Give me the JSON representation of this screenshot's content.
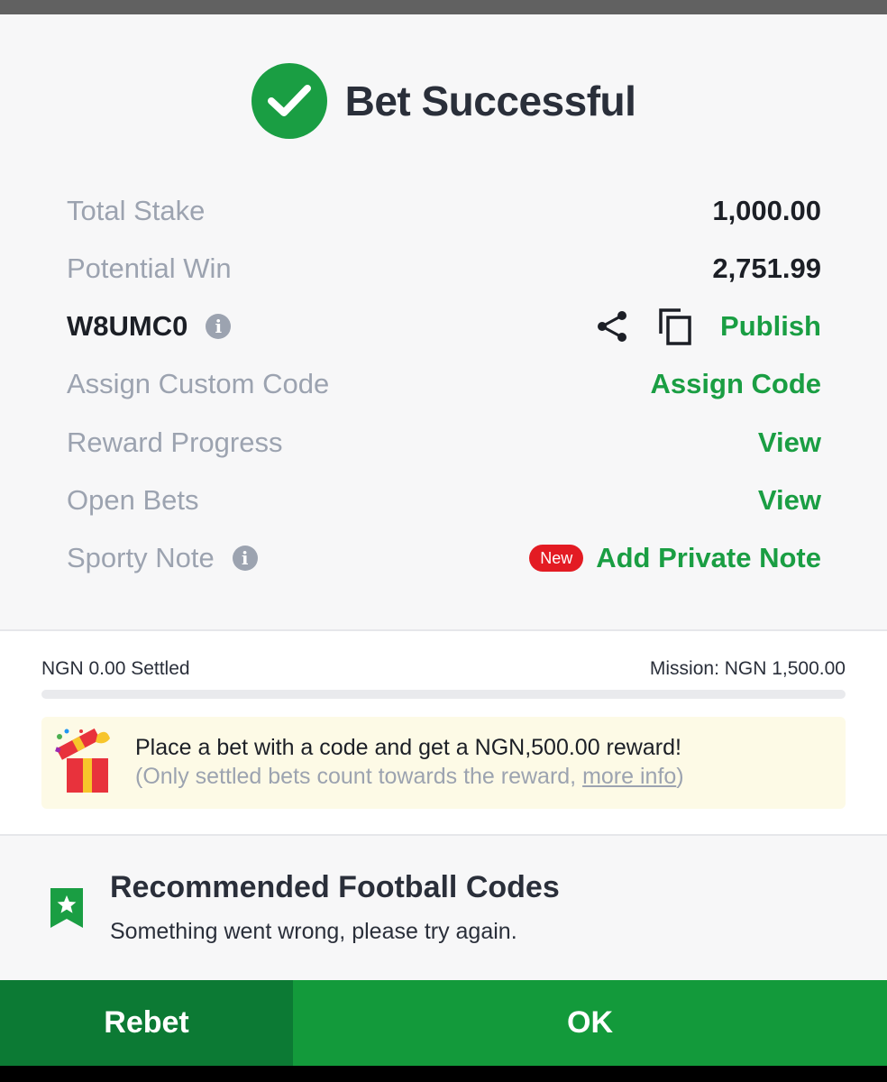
{
  "header": {
    "title": "Bet Successful"
  },
  "summary": {
    "total_stake_label": "Total Stake",
    "total_stake_value": "1,000.00",
    "potential_win_label": "Potential Win",
    "potential_win_value": "2,751.99",
    "booking_code": "W8UMC0",
    "publish_label": "Publish",
    "assign_custom_code_label": "Assign Custom Code",
    "assign_code_link": "Assign Code",
    "reward_progress_label": "Reward Progress",
    "reward_progress_link": "View",
    "open_bets_label": "Open Bets",
    "open_bets_link": "View",
    "sporty_note_label": "Sporty Note",
    "new_badge": "New",
    "add_private_note_link": "Add Private Note"
  },
  "mission": {
    "settled": "NGN 0.00 Settled",
    "target": "Mission: NGN 1,500.00",
    "progress_fraction": 0.0,
    "promo_main": "Place a bet with a code and get a NGN,500.00 reward!",
    "promo_sub_prefix": "(Only settled bets count towards the reward, ",
    "promo_more_info": "more info",
    "promo_sub_suffix": ")"
  },
  "recommended": {
    "title": "Recommended Football Codes",
    "message": "Something went wrong, please try again."
  },
  "footer": {
    "rebet_label": "Rebet",
    "ok_label": "OK"
  },
  "colors": {
    "accent_green": "#1a9e43",
    "dark_green": "#0c7a34",
    "badge_red": "#e31b23"
  },
  "icons": [
    "check-circle-icon",
    "info-icon",
    "share-icon",
    "copy-icon",
    "gift-icon",
    "bookmark-star-icon"
  ]
}
